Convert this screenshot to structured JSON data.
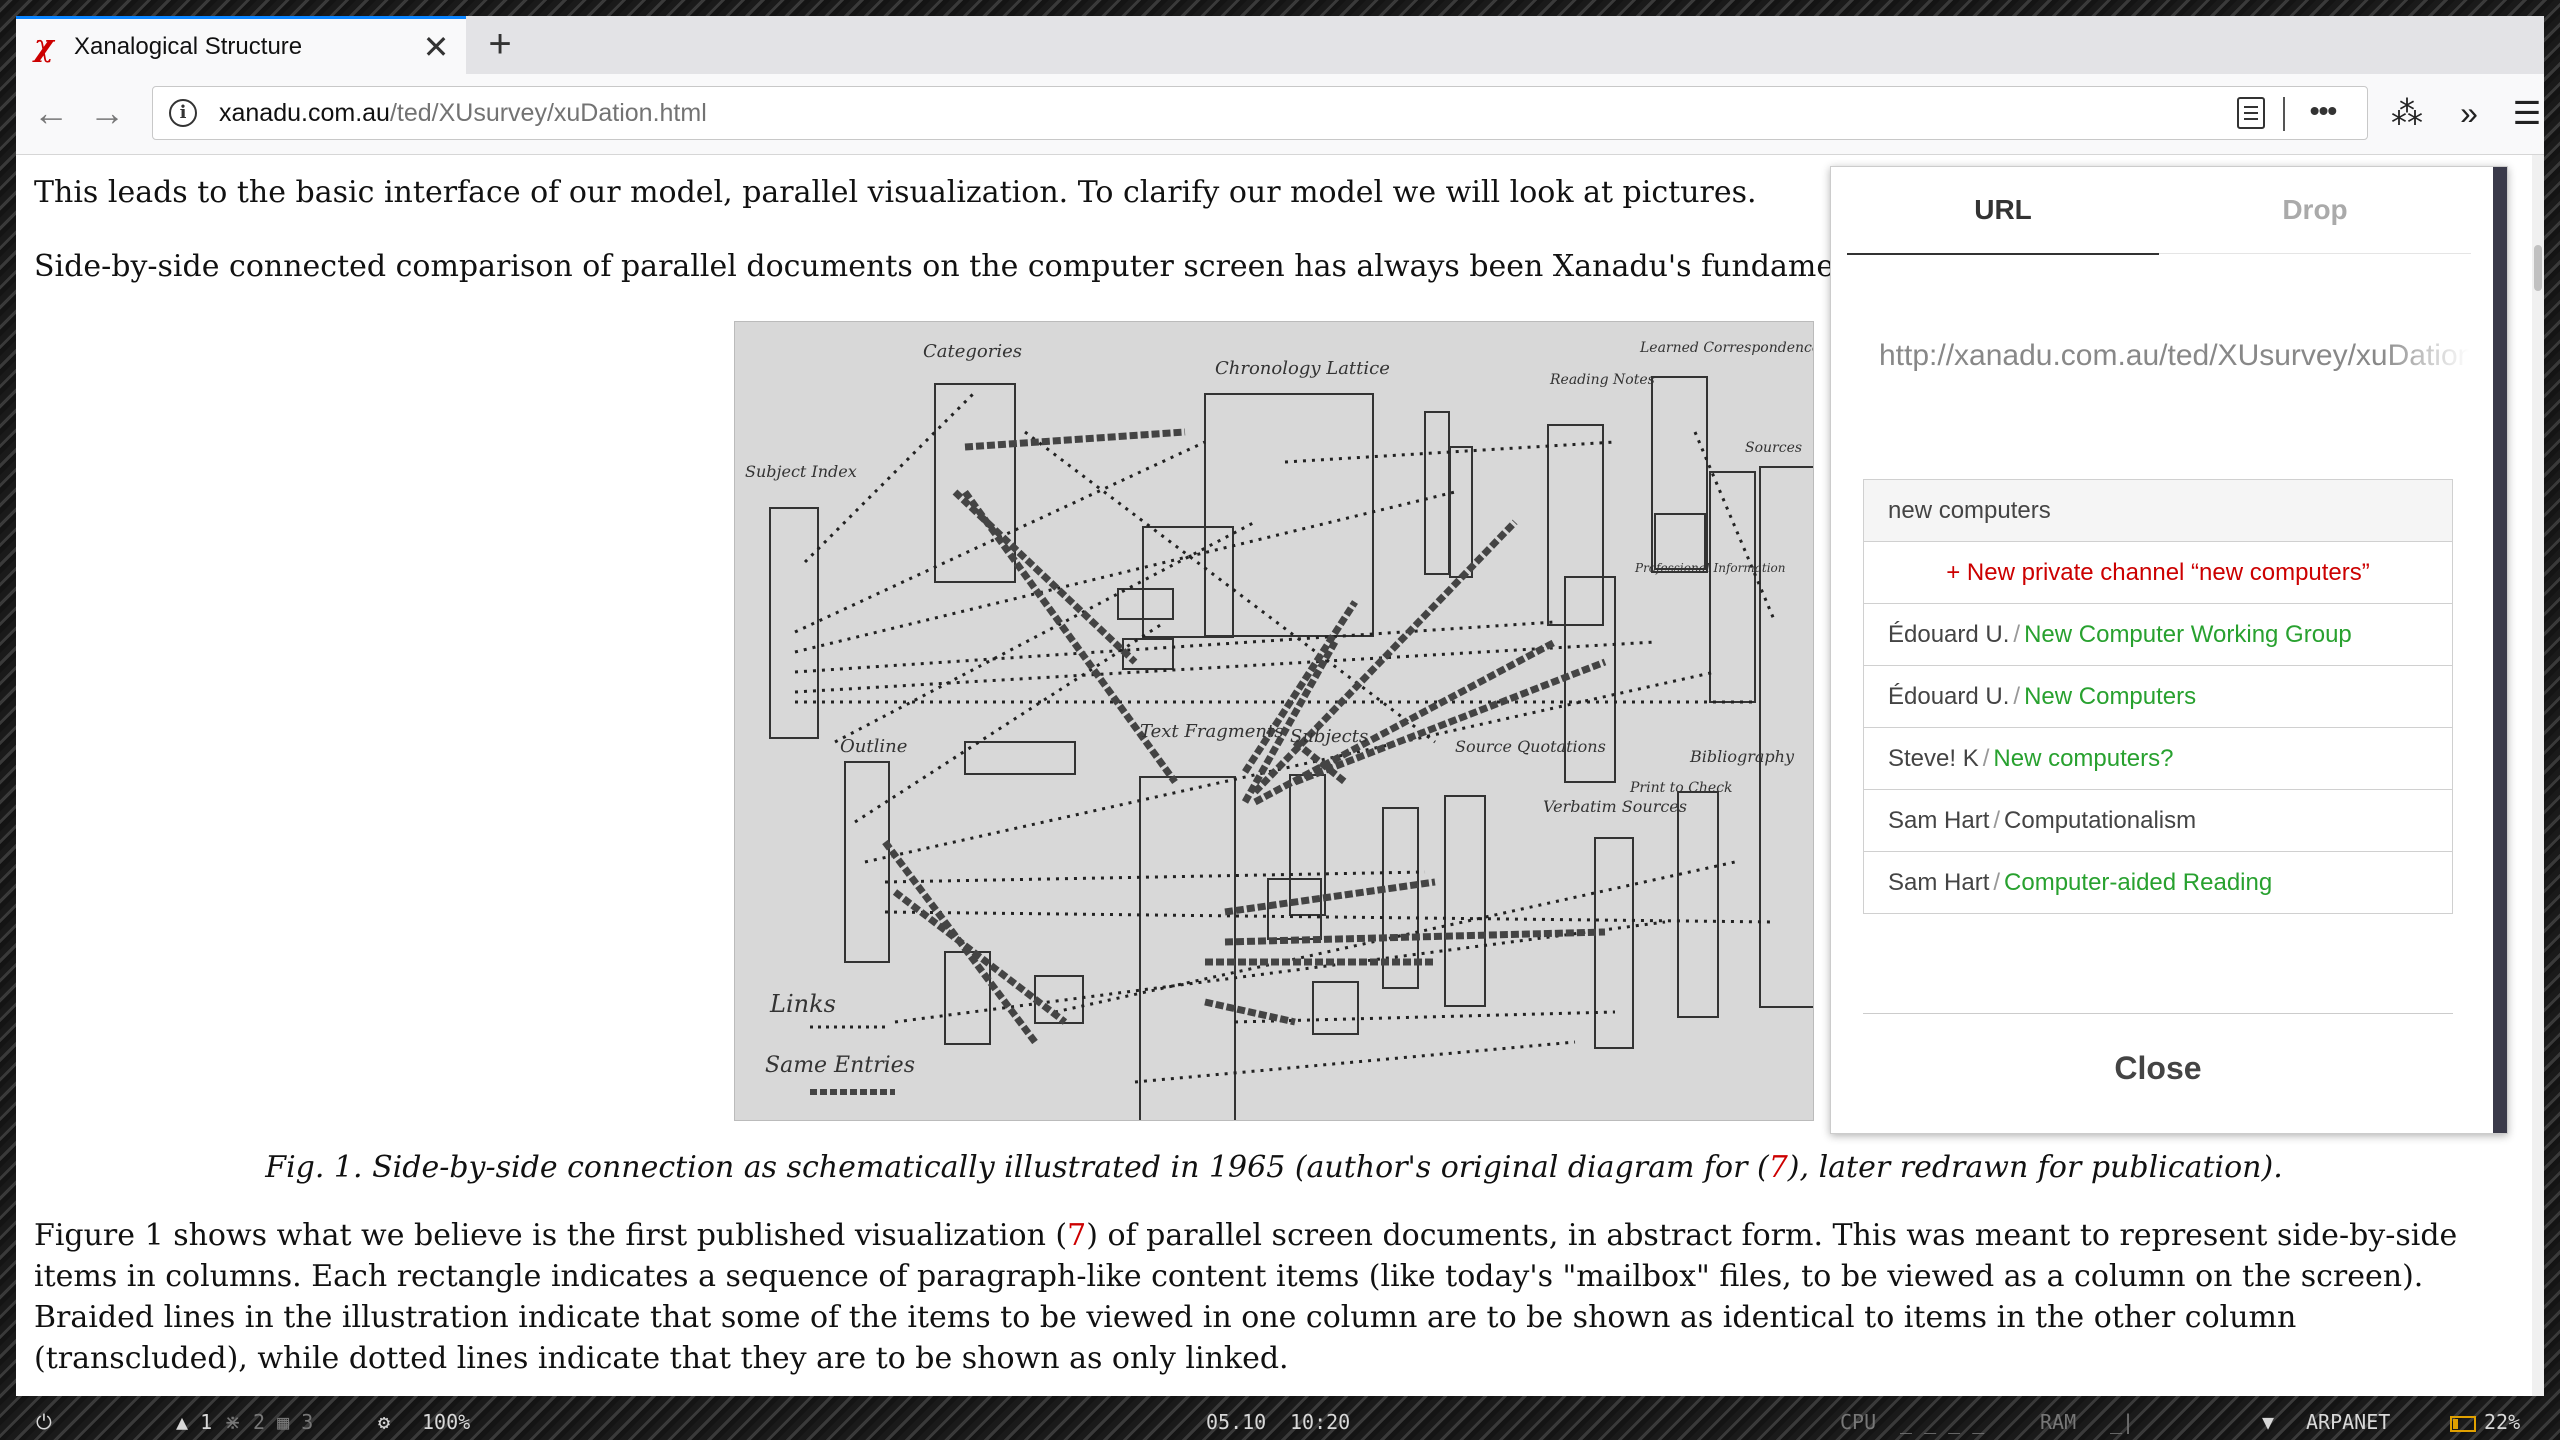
{
  "browser": {
    "tab": {
      "title": "Xanalogical Structure",
      "favicon": "χ",
      "close": "✕"
    },
    "new_tab": "+",
    "url": {
      "domain": "xanadu.com.au",
      "path": "/ted/XUsurvey/xuDation.html"
    },
    "more": "•••"
  },
  "page": {
    "line1": "This leads to the basic interface of our model, parallel visualization.  To clarify our model we will look at pictures.",
    "line2": "Side-by-side connected comparison of parallel documents on the computer screen has always been Xanadu's fundamental visu",
    "figure_labels": {
      "categories": "Categories",
      "chronology": "Chronology Lattice",
      "reading_notes": "Reading Notes",
      "learned": "Learned Correspondence",
      "sources": "Sources",
      "subject_index": "Subject Index",
      "outline": "Outline",
      "text_fragments": "Text Fragments",
      "subjects": "Subjects",
      "source_quotations": "Source Quotations",
      "verbatim_sources": "Verbatim Sources",
      "bibliography": "Bibliography",
      "links": "Links",
      "same_entries": "Same Entries",
      "professional": "Professional Information",
      "print_check": "Print to Check"
    },
    "caption": {
      "a": "Fig. 1.  Side-by-side connection as schematically illustrated in 1965 (author's original diagram for (",
      "ref": "7",
      "b": "), later redrawn for publication)."
    },
    "para": {
      "a": "Figure 1 shows what we believe is the first published visualization (",
      "ref": "7",
      "b": ") of parallel screen documents, in abstract form.  This was meant to represent side-by-side items in columns.  Each rectangle indicates a sequence of paragraph-like content items (like today's \"mailbox\" files, to be viewed as a column on the screen).  Braided lines in the illustration indicate that some of the items to be viewed in one column are to be shown as identical to items in the other column (transcluded), while dotted lines indicate that they are to be shown as only linked."
    }
  },
  "popup": {
    "tabs": [
      "URL",
      "Drop"
    ],
    "url_value": "http://xanadu.com.au/ted/XUsurvey/xuDation.html",
    "search_value": "new computers",
    "create_label": "+ New private channel “new computers”",
    "results": [
      {
        "user": "Édouard U.",
        "channel": "New Computer Working Group",
        "color": "green"
      },
      {
        "user": "Édouard U.",
        "channel": "New Computers",
        "color": "green"
      },
      {
        "user": "Steve! K",
        "channel": "New computers?",
        "color": "green"
      },
      {
        "user": "Sam Hart",
        "channel": "Computationalism",
        "color": "dark"
      },
      {
        "user": "Sam Hart",
        "channel": "Computer-aided Reading",
        "color": "green"
      }
    ],
    "close_label": "Close"
  },
  "statusbar": {
    "power": "⏻",
    "workspaces": [
      "1",
      "2",
      "3"
    ],
    "brightness": "100%",
    "date": "05.10",
    "time": "10:20",
    "cpu": "CPU",
    "ram": "RAM",
    "network": "ARPANET",
    "battery": "22%"
  },
  "colors": {
    "accent": "#0a84ff",
    "link_red": "#cc0000",
    "channel_green": "#28a12f"
  }
}
